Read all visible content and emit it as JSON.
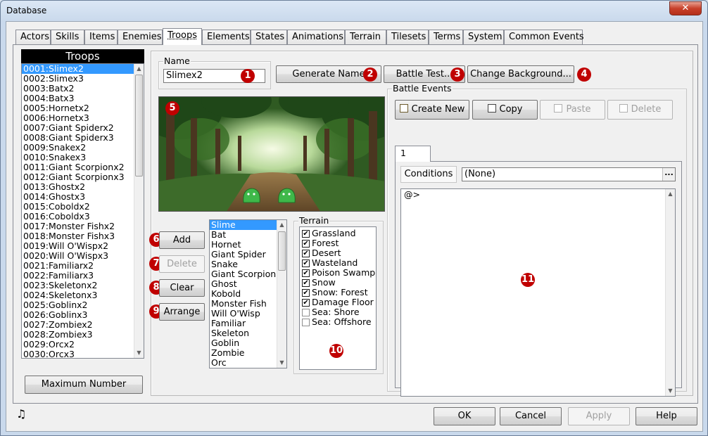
{
  "window": {
    "title": "Database",
    "close_glyph": "✕"
  },
  "tabs": [
    {
      "label": "Actors"
    },
    {
      "label": "Skills"
    },
    {
      "label": "Items"
    },
    {
      "label": "Enemies"
    },
    {
      "label": "Troops"
    },
    {
      "label": "Elements"
    },
    {
      "label": "States"
    },
    {
      "label": "Animations"
    },
    {
      "label": "Terrain"
    },
    {
      "label": "Tilesets"
    },
    {
      "label": "Terms"
    },
    {
      "label": "System"
    },
    {
      "label": "Common Events"
    }
  ],
  "troop_list": {
    "header": "Troops",
    "items": [
      "0001:Slimex2",
      "0002:Slimex3",
      "0003:Batx2",
      "0004:Batx3",
      "0005:Hornetx2",
      "0006:Hornetx3",
      "0007:Giant Spiderx2",
      "0008:Giant Spiderx3",
      "0009:Snakex2",
      "0010:Snakex3",
      "0011:Giant Scorpionx2",
      "0012:Giant Scorpionx3",
      "0013:Ghostx2",
      "0014:Ghostx3",
      "0015:Coboldx2",
      "0016:Coboldx3",
      "0017:Monster Fishx2",
      "0018:Monster Fishx3",
      "0019:Will O'Wispx2",
      "0020:Will O'Wispx3",
      "0021:Familiarx2",
      "0022:Familiarx3",
      "0023:Skeletonx2",
      "0024:Skeletonx3",
      "0025:Goblinx2",
      "0026:Goblinx3",
      "0027:Zombiex2",
      "0028:Zombiex3",
      "0029:Orcx2",
      "0030:Orcx3"
    ],
    "max_button": "Maximum Number"
  },
  "name_group": {
    "label": "Name",
    "value": "Slimex2"
  },
  "buttons": {
    "generate_name": "Generate Name",
    "battle_test": "Battle Test...",
    "change_background": "Change Background...",
    "add": "Add",
    "delete": "Delete",
    "clear": "Clear",
    "arrange": "Arrange"
  },
  "markers": [
    "1",
    "2",
    "3",
    "4",
    "5",
    "6",
    "7",
    "8",
    "9",
    "10",
    "11"
  ],
  "enemy_list": {
    "items": [
      "Slime",
      "Bat",
      "Hornet",
      "Giant Spider",
      "Snake",
      "Giant Scorpion",
      "Ghost",
      "Kobold",
      "Monster Fish",
      "Will O'Wisp",
      "Familiar",
      "Skeleton",
      "Goblin",
      "Zombie",
      "Orc"
    ]
  },
  "terrain": {
    "label": "Terrain",
    "items": [
      {
        "label": "Grassland",
        "checked": true
      },
      {
        "label": "Forest",
        "checked": true
      },
      {
        "label": "Desert",
        "checked": true
      },
      {
        "label": "Wasteland",
        "checked": true
      },
      {
        "label": "Poison Swamp",
        "checked": true
      },
      {
        "label": "Snow",
        "checked": true
      },
      {
        "label": "Snow: Forest",
        "checked": true
      },
      {
        "label": "Damage Floor",
        "checked": true
      },
      {
        "label": "Sea: Shore",
        "checked": false
      },
      {
        "label": "Sea: Offshore",
        "checked": false
      }
    ],
    "check_glyph": "✔"
  },
  "battle_events": {
    "label": "Battle Events",
    "create_new": "Create New",
    "copy": "Copy",
    "paste": "Paste",
    "delete": "Delete",
    "page_tab": "1",
    "conditions_label": "Conditions",
    "conditions_value": "(None)",
    "conditions_button": "...",
    "content_line": "@>"
  },
  "footer": {
    "ok": "OK",
    "cancel": "Cancel",
    "apply": "Apply",
    "help": "Help",
    "music_glyph": "♫"
  },
  "colors": {
    "selection": "#3399ff",
    "marker": "#c00000"
  }
}
